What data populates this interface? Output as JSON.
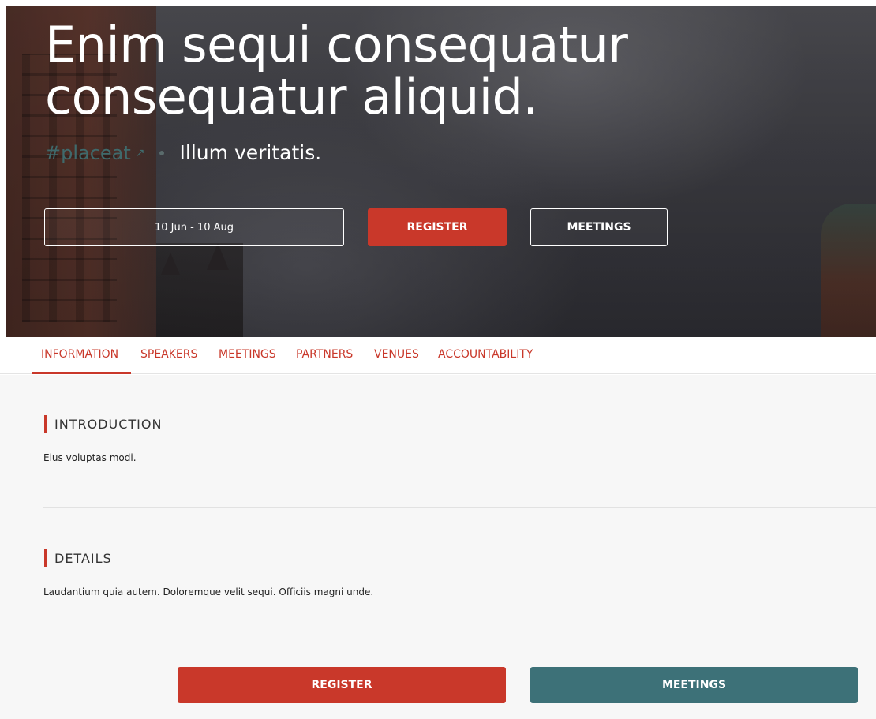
{
  "hero": {
    "title": "Enim sequi consequatur consequatur aliquid.",
    "hashtag": "#placeat",
    "external_icon": "external-link-icon",
    "subtitle": "Illum veritatis.",
    "date_range": "10 Jun - 10 Aug",
    "register_label": "REGISTER",
    "meetings_label": "MEETINGS"
  },
  "tabs": [
    {
      "label": "INFORMATION",
      "active": true
    },
    {
      "label": "SPEAKERS",
      "active": false
    },
    {
      "label": "MEETINGS",
      "active": false
    },
    {
      "label": "PARTNERS",
      "active": false
    },
    {
      "label": "VENUES",
      "active": false
    },
    {
      "label": "ACCOUNTABILITY",
      "active": false
    }
  ],
  "sections": {
    "introduction": {
      "heading": "INTRODUCTION",
      "body": "Eius voluptas modi."
    },
    "details": {
      "heading": "DETAILS",
      "body": "Laudantium quia autem. Doloremque velit sequi. Officiis magni unde."
    }
  },
  "footer_actions": {
    "register_label": "REGISTER",
    "meetings_label": "MEETINGS"
  },
  "colors": {
    "accent": "#c9382a",
    "secondary": "#3d7178",
    "hashtag": "#3f6a6c",
    "content_bg": "#f7f7f7"
  }
}
